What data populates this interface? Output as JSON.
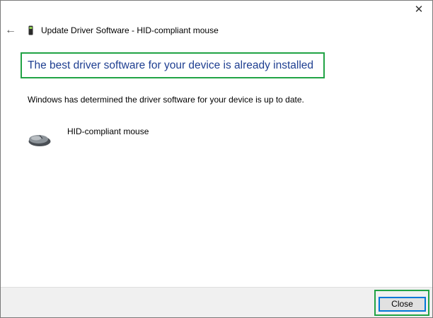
{
  "window": {
    "close_glyph": "✕",
    "back_glyph": "←",
    "title": "Update Driver Software - HID-compliant mouse",
    "title_icon": "device-icon"
  },
  "main": {
    "headline": "The best driver software for your device is already installed",
    "message": "Windows has determined the driver software for your device is up to date.",
    "device": {
      "name": "HID-compliant mouse",
      "icon": "mouse-icon"
    }
  },
  "footer": {
    "close_label": "Close"
  },
  "colors": {
    "headline": "#1f3f91",
    "highlight_border": "#21a345",
    "button_focus": "#0078d7",
    "footer_bg": "#f0f0f0"
  }
}
